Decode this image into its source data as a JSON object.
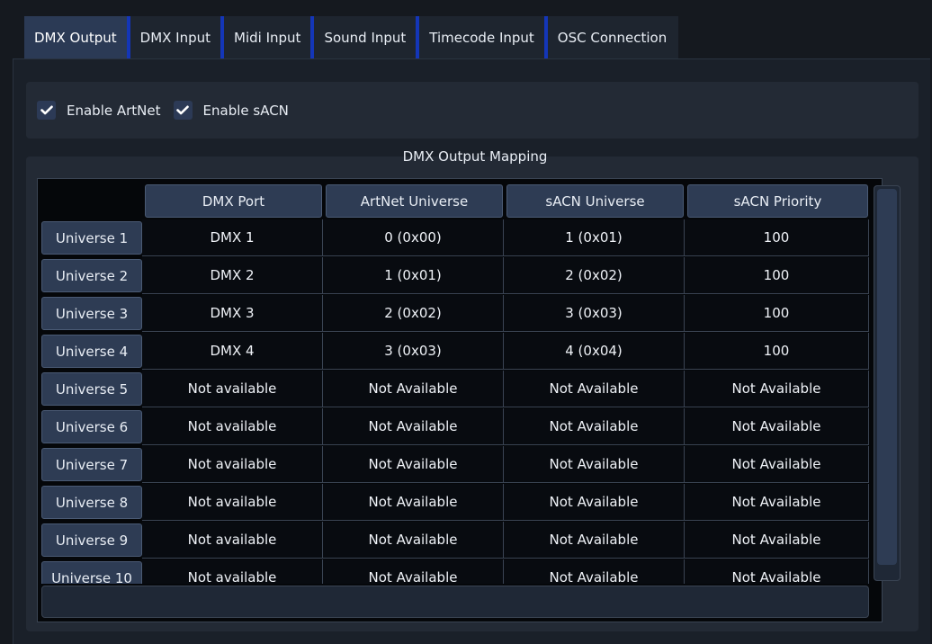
{
  "tabs": [
    {
      "label": "DMX Output",
      "active": true
    },
    {
      "label": "DMX Input",
      "active": false
    },
    {
      "label": "Midi Input",
      "active": false
    },
    {
      "label": "Sound Input",
      "active": false
    },
    {
      "label": "Timecode Input",
      "active": false
    },
    {
      "label": "OSC Connection",
      "active": false
    }
  ],
  "options": {
    "artnet_label": "Enable ArtNet",
    "artnet_checked": true,
    "sacn_label": "Enable sACN",
    "sacn_checked": true
  },
  "mapping": {
    "title": "DMX Output Mapping",
    "columns": [
      "DMX Port",
      "ArtNet Universe",
      "sACN Universe",
      "sACN Priority"
    ],
    "rows": [
      {
        "label": "Universe 1",
        "cells": [
          "DMX 1",
          "0 (0x00)",
          "1 (0x01)",
          "100"
        ]
      },
      {
        "label": "Universe 2",
        "cells": [
          "DMX 2",
          "1 (0x01)",
          "2 (0x02)",
          "100"
        ]
      },
      {
        "label": "Universe 3",
        "cells": [
          "DMX 3",
          "2 (0x02)",
          "3 (0x03)",
          "100"
        ]
      },
      {
        "label": "Universe 4",
        "cells": [
          "DMX 4",
          "3 (0x03)",
          "4 (0x04)",
          "100"
        ]
      },
      {
        "label": "Universe 5",
        "cells": [
          "Not available",
          "Not Available",
          "Not Available",
          "Not Available"
        ]
      },
      {
        "label": "Universe 6",
        "cells": [
          "Not available",
          "Not Available",
          "Not Available",
          "Not Available"
        ]
      },
      {
        "label": "Universe 7",
        "cells": [
          "Not available",
          "Not Available",
          "Not Available",
          "Not Available"
        ]
      },
      {
        "label": "Universe 8",
        "cells": [
          "Not available",
          "Not Available",
          "Not Available",
          "Not Available"
        ]
      },
      {
        "label": "Universe 9",
        "cells": [
          "Not available",
          "Not Available",
          "Not Available",
          "Not Available"
        ]
      },
      {
        "label": "Universe 10",
        "cells": [
          "Not available",
          "Not Available",
          "Not Available",
          "Not Available"
        ]
      }
    ]
  },
  "colors": {
    "accent": "#1436b8",
    "background": "#15191f",
    "header": "#2e3c54"
  }
}
